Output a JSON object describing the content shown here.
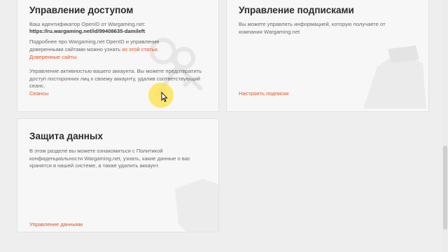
{
  "access_card": {
    "title": "Управление доступом",
    "openid_label": "Ваш идентификатор OpenID от Wargaming.net:",
    "openid_url": "https://ru.wargaming.net/id/99408635-damileft",
    "more_text": "Подробнее про Wargaming.net OpenID и управление доверенными сайтами можно узнать ",
    "more_link": "из этой статьи",
    "more_end": ".",
    "trusted_sites_link": "Доверенные сайты",
    "activity_text": "Управление активностью вашего аккаунта. Вы можете предотвратить доступ посторонних лиц к своему аккаунту, удалив соответствующий сеанс.",
    "sessions_link": "Сеансы"
  },
  "subscriptions_card": {
    "title": "Управление подписками",
    "text": "Вы можете управлять информацией, которую получаете от компании Wargaming.net",
    "configure_link": "Настроить подписки"
  },
  "data_card": {
    "title": "Защита данных",
    "text": "В этом разделе вы можете ознакомиться с Политикой конфиденциальности Wargaming.net, узнать, какие данные о вас хранятся в нашей системе, а также удалить аккаунт.",
    "manage_link": "Управление данными"
  },
  "colors": {
    "accent": "#e0552b",
    "card_bg": "#f7f7f7",
    "page_bg": "#eeeeee"
  }
}
